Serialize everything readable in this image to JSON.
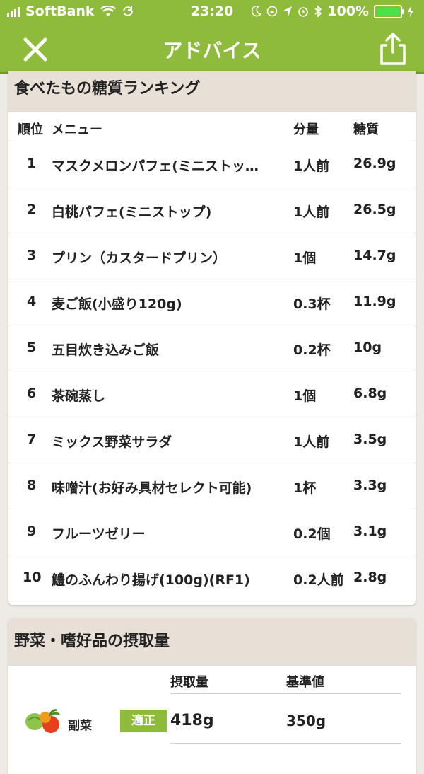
{
  "status": {
    "carrier": "SoftBank",
    "time": "23:20",
    "battery": "100%"
  },
  "nav": {
    "title": "アドバイス"
  },
  "ranking": {
    "title": "食べたもの糖質ランキング",
    "headers": {
      "rank": "順位",
      "menu": "メニュー",
      "amount": "分量",
      "sugar": "糖質"
    },
    "rows": [
      {
        "rank": "1",
        "menu": "マスクメロンパフェ(ミニストッ…",
        "amount": "1人前",
        "sugar": "26.9g"
      },
      {
        "rank": "2",
        "menu": "白桃パフェ(ミニストップ)",
        "amount": "1人前",
        "sugar": "26.5g"
      },
      {
        "rank": "3",
        "menu": "プリン（カスタードプリン）",
        "amount": "1個",
        "sugar": "14.7g"
      },
      {
        "rank": "4",
        "menu": "麦ご飯(小盛り120g)",
        "amount": "0.3杯",
        "sugar": "11.9g"
      },
      {
        "rank": "5",
        "menu": "五目炊き込みご飯",
        "amount": "0.2杯",
        "sugar": "10g"
      },
      {
        "rank": "6",
        "menu": "茶碗蒸し",
        "amount": "1個",
        "sugar": "6.8g"
      },
      {
        "rank": "7",
        "menu": "ミックス野菜サラダ",
        "amount": "1人前",
        "sugar": "3.5g"
      },
      {
        "rank": "8",
        "menu": "味噌汁(お好み具材セレクト可能)",
        "amount": "1杯",
        "sugar": "3.3g"
      },
      {
        "rank": "9",
        "menu": "フルーツゼリー",
        "amount": "0.2個",
        "sugar": "3.1g"
      },
      {
        "rank": "10",
        "menu": "鱧のふんわり揚げ(100g)(RF1)",
        "amount": "0.2人前",
        "sugar": "2.8g"
      }
    ]
  },
  "intake": {
    "title": "野菜・嗜好品の摂取量",
    "headers": {
      "intake": "摂取量",
      "standard": "基準値"
    },
    "rows": [
      {
        "category": "副菜",
        "badge": "適正",
        "intake": "418g",
        "standard": "350g",
        "icon": "vegetables-icon"
      }
    ]
  },
  "colors": {
    "accent": "#8ebb3c",
    "header_bg": "#e8dfd7"
  }
}
